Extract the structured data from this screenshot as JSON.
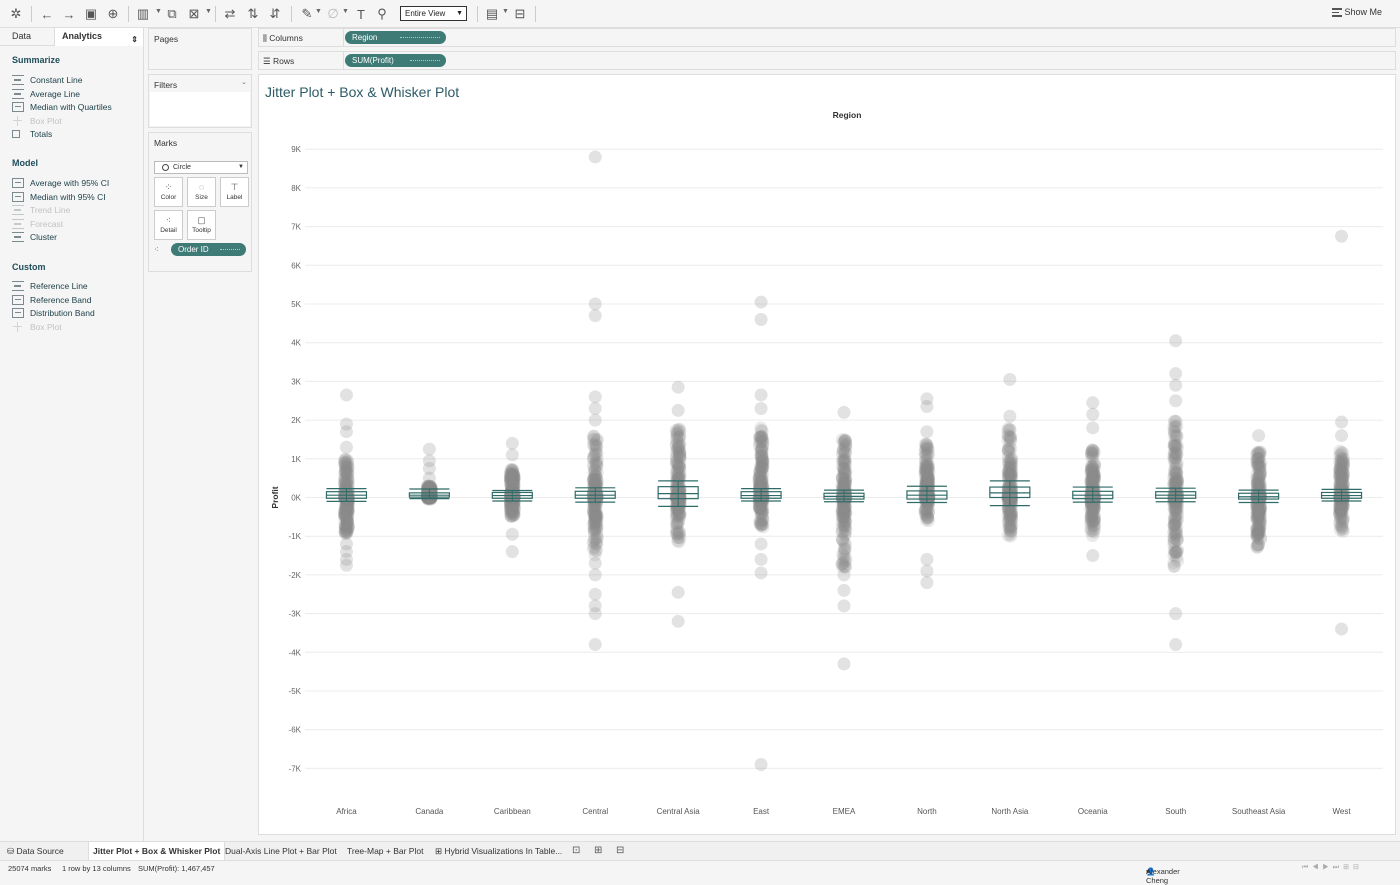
{
  "toolbar": {
    "view_select": "Entire View",
    "show_me": "Show Me"
  },
  "left_tabs": {
    "data": "Data",
    "analytics": "Analytics"
  },
  "analytics": {
    "summarize_title": "Summarize",
    "summarize": [
      {
        "label": "Constant Line",
        "icon": "lines",
        "enabled": true
      },
      {
        "label": "Average Line",
        "icon": "lines",
        "enabled": true
      },
      {
        "label": "Median with Quartiles",
        "icon": "box",
        "enabled": true
      },
      {
        "label": "Box Plot",
        "icon": "plus",
        "enabled": false
      },
      {
        "label": "Totals",
        "icon": "sq",
        "enabled": true
      }
    ],
    "model_title": "Model",
    "model": [
      {
        "label": "Average with 95% CI",
        "icon": "box",
        "enabled": true
      },
      {
        "label": "Median with 95% CI",
        "icon": "box",
        "enabled": true
      },
      {
        "label": "Trend Line",
        "icon": "lines",
        "enabled": false
      },
      {
        "label": "Forecast",
        "icon": "lines",
        "enabled": false
      },
      {
        "label": "Cluster",
        "icon": "lines",
        "enabled": true
      }
    ],
    "custom_title": "Custom",
    "custom": [
      {
        "label": "Reference Line",
        "icon": "lines",
        "enabled": true
      },
      {
        "label": "Reference Band",
        "icon": "box",
        "enabled": true
      },
      {
        "label": "Distribution Band",
        "icon": "box",
        "enabled": true
      },
      {
        "label": "Box Plot",
        "icon": "plus",
        "enabled": false
      }
    ]
  },
  "cards": {
    "pages": "Pages",
    "filters": "Filters",
    "marks": "Marks",
    "mark_type": "Circle",
    "buttons": {
      "color": "Color",
      "size": "Size",
      "label": "Label",
      "detail": "Detail",
      "tooltip": "Tooltip"
    },
    "detail_pill": "Order ID"
  },
  "shelves": {
    "columns_label": "Columns",
    "columns_pill": "Region",
    "rows_label": "Rows",
    "rows_pill": "SUM(Profit)"
  },
  "sheet_title": "Jitter Plot + Box & Whisker Plot",
  "chart_data": {
    "type": "scatter",
    "title": "Jitter Plot + Box & Whisker Plot",
    "xlabel": "Region",
    "ylabel": "Profit",
    "categories": [
      "Africa",
      "Canada",
      "Caribbean",
      "Central",
      "Central Asia",
      "East",
      "EMEA",
      "North",
      "North Asia",
      "Oceania",
      "South",
      "Southeast Asia",
      "West"
    ],
    "y_ticks": [
      "9K",
      "8K",
      "7K",
      "6K",
      "5K",
      "4K",
      "3K",
      "2K",
      "1K",
      "0K",
      "-1K",
      "-2K",
      "-3K",
      "-4K",
      "-5K",
      "-6K",
      "-7K"
    ],
    "ylim": [
      -7800,
      9300
    ],
    "grid": true,
    "mark_color": "#8c8c8c",
    "box_color": "#2f6b68",
    "series": [
      {
        "name": "Africa",
        "dense": [
          -1000,
          1000
        ],
        "sparse": [
          2650,
          1900,
          1700,
          1300,
          -1200,
          -1400,
          -1600,
          -1750
        ],
        "box": {
          "q1": -20,
          "median": 60,
          "q3": 150,
          "low": -100,
          "high": 230
        }
      },
      {
        "name": "Canada",
        "dense": [
          -50,
          300
        ],
        "sparse": [
          1250,
          950,
          750,
          500
        ],
        "box": {
          "q1": 10,
          "median": 60,
          "q3": 120,
          "low": -30,
          "high": 220
        }
      },
      {
        "name": "Caribbean",
        "dense": [
          -500,
          750
        ],
        "sparse": [
          1400,
          1100,
          -950,
          -1400
        ],
        "box": {
          "q1": -20,
          "median": 50,
          "q3": 130,
          "low": -90,
          "high": 180
        }
      },
      {
        "name": "Central",
        "dense": [
          -1500,
          1600
        ],
        "sparse": [
          8800,
          5000,
          4700,
          2600,
          2300,
          2000,
          -1700,
          -2000,
          -2500,
          -2800,
          -3000,
          -3800
        ],
        "box": {
          "q1": -20,
          "median": 60,
          "q3": 160,
          "low": -120,
          "high": 250
        }
      },
      {
        "name": "Central Asia",
        "dense": [
          -1200,
          1800
        ],
        "sparse": [
          2850,
          2250,
          -2450,
          -3200
        ],
        "box": {
          "q1": -30,
          "median": 100,
          "q3": 280,
          "low": -230,
          "high": 430
        }
      },
      {
        "name": "East",
        "dense": [
          -900,
          1800
        ],
        "sparse": [
          5050,
          4600,
          2650,
          2300,
          -1200,
          -1600,
          -1950,
          -6900
        ],
        "box": {
          "q1": -20,
          "median": 50,
          "q3": 150,
          "low": -90,
          "high": 230
        }
      },
      {
        "name": "EMEA",
        "dense": [
          -1800,
          1500
        ],
        "sparse": [
          2200,
          -2000,
          -2400,
          -2800,
          -4300
        ],
        "box": {
          "q1": -40,
          "median": 30,
          "q3": 110,
          "low": -110,
          "high": 190
        }
      },
      {
        "name": "North",
        "dense": [
          -600,
          1400
        ],
        "sparse": [
          2550,
          2350,
          1700,
          -1600,
          -1900,
          -2200
        ],
        "box": {
          "q1": -40,
          "median": 60,
          "q3": 170,
          "low": -130,
          "high": 290
        }
      },
      {
        "name": "North Asia",
        "dense": [
          -1000,
          1800
        ],
        "sparse": [
          3050,
          2100
        ],
        "box": {
          "q1": 0,
          "median": 120,
          "q3": 270,
          "low": -210,
          "high": 430
        }
      },
      {
        "name": "Oceania",
        "dense": [
          -1000,
          1300
        ],
        "sparse": [
          2450,
          2150,
          1800,
          -1500
        ],
        "box": {
          "q1": -30,
          "median": 60,
          "q3": 160,
          "low": -120,
          "high": 270
        }
      },
      {
        "name": "South",
        "dense": [
          -1800,
          2000
        ],
        "sparse": [
          4050,
          3200,
          2900,
          2500,
          -3000,
          -3800
        ],
        "box": {
          "q1": -20,
          "median": 60,
          "q3": 150,
          "low": -110,
          "high": 240
        }
      },
      {
        "name": "Southeast Asia",
        "dense": [
          -1300,
          1200
        ],
        "sparse": [
          1600
        ],
        "box": {
          "q1": -40,
          "median": 20,
          "q3": 110,
          "low": -130,
          "high": 190
        }
      },
      {
        "name": "West",
        "dense": [
          -900,
          1200
        ],
        "sparse": [
          6750,
          1950,
          1600,
          -3400
        ],
        "box": {
          "q1": -20,
          "median": 50,
          "q3": 130,
          "low": -90,
          "high": 210
        }
      }
    ]
  },
  "bottom_tabs": {
    "data_source": "Data Source",
    "tabs": [
      "Jitter Plot + Box & Whisker Plot",
      "Dual-Axis Line Plot + Bar Plot",
      "Tree-Map + Bar Plot",
      "Hybrid Visualizations In Table..."
    ]
  },
  "status": {
    "marks": "25074 marks",
    "dims": "1 row by 13 columns",
    "sum": "SUM(Profit): 1,467,457",
    "user": "Alexander Cheng"
  }
}
